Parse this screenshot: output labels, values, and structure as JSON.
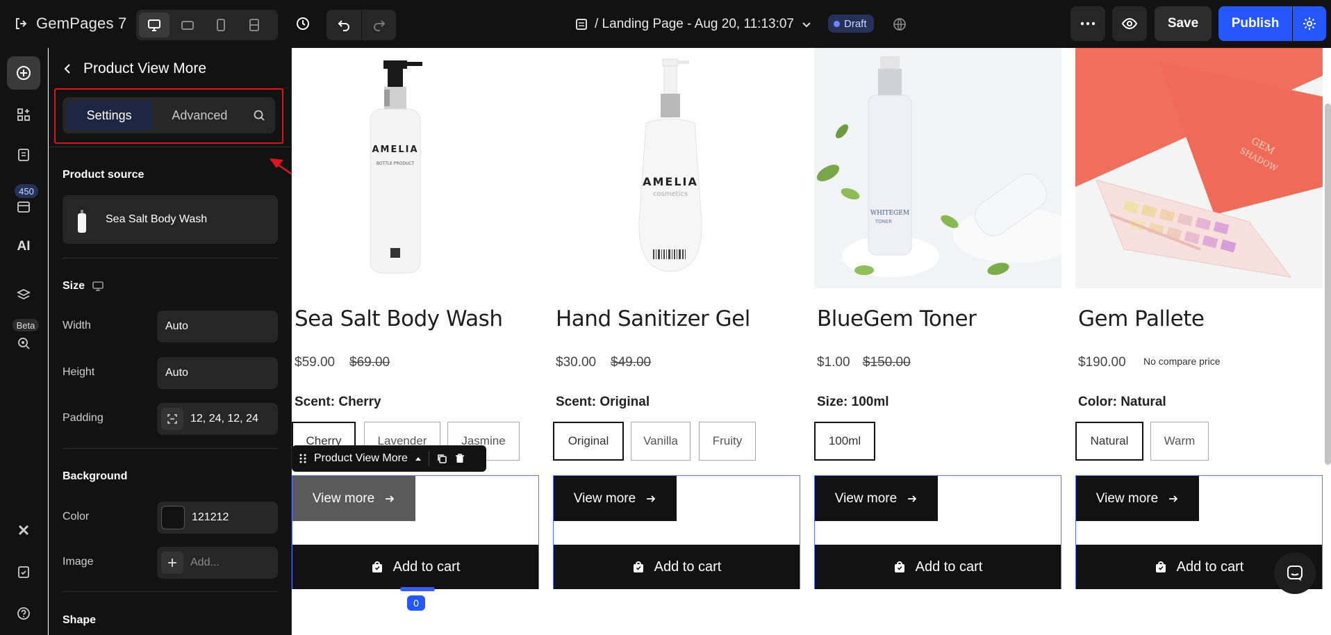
{
  "topbar": {
    "logo_text": "GemPages 7",
    "page_title": "/ Landing Page - Aug 20, 11:13:07",
    "status": "Draft",
    "save_label": "Save",
    "publish_label": "Publish"
  },
  "rail": {
    "badge_count": "450",
    "ai_label": "AI",
    "beta_label": "Beta"
  },
  "panel": {
    "title": "Product View More",
    "tabs": {
      "settings": "Settings",
      "advanced": "Advanced"
    },
    "product_source_label": "Product source",
    "product_source_value": "Sea Salt Body Wash",
    "size_label": "Size",
    "width_label": "Width",
    "width_value": "Auto",
    "height_label": "Height",
    "height_value": "Auto",
    "padding_label": "Padding",
    "padding_value": "12, 24, 12, 24",
    "background_label": "Background",
    "color_label": "Color",
    "color_value": "121212",
    "image_label": "Image",
    "image_placeholder": "Add...",
    "shape_label": "Shape"
  },
  "canvas": {
    "toolbar_label": "Product View More",
    "handle_badge": "0",
    "products": [
      {
        "title": "Sea Salt Body Wash",
        "price": "$59.00",
        "compare_price": "$69.00",
        "option_title": "Scent: Cherry",
        "options": [
          "Cherry",
          "Lavender",
          "Jasmine"
        ],
        "view_more": "View more",
        "add_to_cart": "Add to cart"
      },
      {
        "title": "Hand Sanitizer Gel",
        "price": "$30.00",
        "compare_price": "$49.00",
        "option_title": "Scent: Original",
        "options": [
          "Original",
          "Vanilla",
          "Fruity"
        ],
        "view_more": "View more",
        "add_to_cart": "Add to cart"
      },
      {
        "title": "BlueGem Toner",
        "price": "$1.00",
        "compare_price": "$150.00",
        "option_title": "Size: 100ml",
        "options": [
          "100ml"
        ],
        "view_more": "View more",
        "add_to_cart": "Add to cart"
      },
      {
        "title": "Gem Pallete",
        "price": "$190.00",
        "compare_price": "No compare price",
        "option_title": "Color: Natural",
        "options": [
          "Natural",
          "Warm"
        ],
        "view_more": "View more",
        "add_to_cart": "Add to cart"
      }
    ],
    "image_texts": {
      "bottle1_brand": "AMELIA",
      "bottle1_sub": "BOTTLE PRODUCT",
      "bottle2_brand": "AMELIA",
      "bottle2_sub": "cosmetics",
      "toner_brand": "WHITEGEM",
      "toner_sub": "TONER",
      "palette_brand": "GEM",
      "palette_sub": "SHADOW"
    }
  },
  "colors": {
    "accent": "#2457ff",
    "dark": "#121212",
    "highlight": "#e0141c",
    "selection": "#5a74ff"
  }
}
